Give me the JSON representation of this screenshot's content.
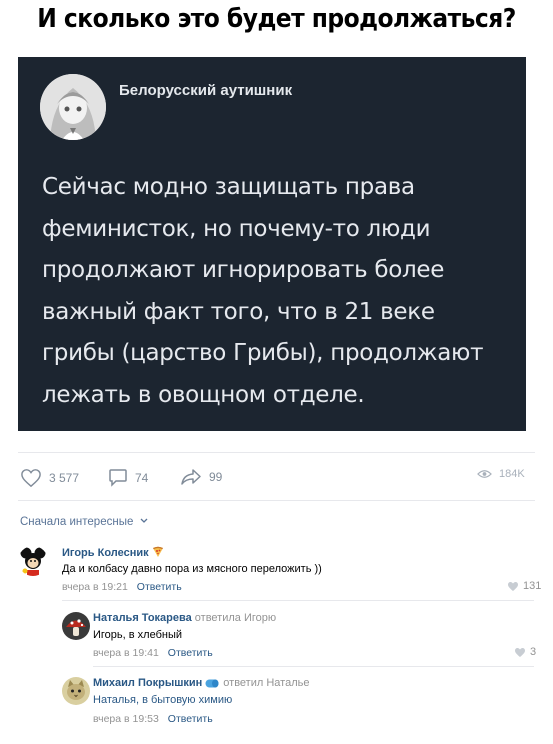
{
  "meme": {
    "title": "И сколько это будет продолжаться?"
  },
  "tweet": {
    "author": "Белорусский аутишник",
    "lines": [
      "Сейчас модно защищать права",
      "феминисток, но почему-то люди",
      "продолжают игнорировать более",
      "важный факт того, что в 21 веке",
      "грибы (царство Грибы), продолжают",
      "лежать в овощном отделе."
    ]
  },
  "stats": {
    "likes": "3 577",
    "comments": "74",
    "reposts": "99",
    "views": "184K"
  },
  "sort": {
    "label": "Сначала интересные"
  },
  "comments": [
    {
      "author": "Игорь Колесник",
      "text": "Да и колбасу давно пора из мясного переложить ))",
      "time": "вчера в 19:21",
      "reply_label": "Ответить",
      "likes": "131",
      "avatar_icon": "mickey-mouse-avatar",
      "emoji_icon": "pizza-emoji"
    },
    {
      "author": "Наталья Токарева",
      "replied_to": "ответила Игорю",
      "text": "Игорь, в хлебный",
      "time": "вчера в 19:41",
      "reply_label": "Ответить",
      "likes": "3",
      "avatar_icon": "mushroom-avatar"
    },
    {
      "author": "Михаил Покрышкин",
      "replied_to": "ответил Наталье",
      "text": "Наталья, в бытовую химию",
      "time": "вчера в 19:53",
      "reply_label": "Ответить",
      "avatar_icon": "cat-avatar",
      "emoji_icon": "pill-emoji"
    }
  ],
  "colors": {
    "tweet_background": "#1c2530",
    "link_blue": "#2a5885",
    "muted_gray": "#939393",
    "icon_gray": "#818c99"
  }
}
